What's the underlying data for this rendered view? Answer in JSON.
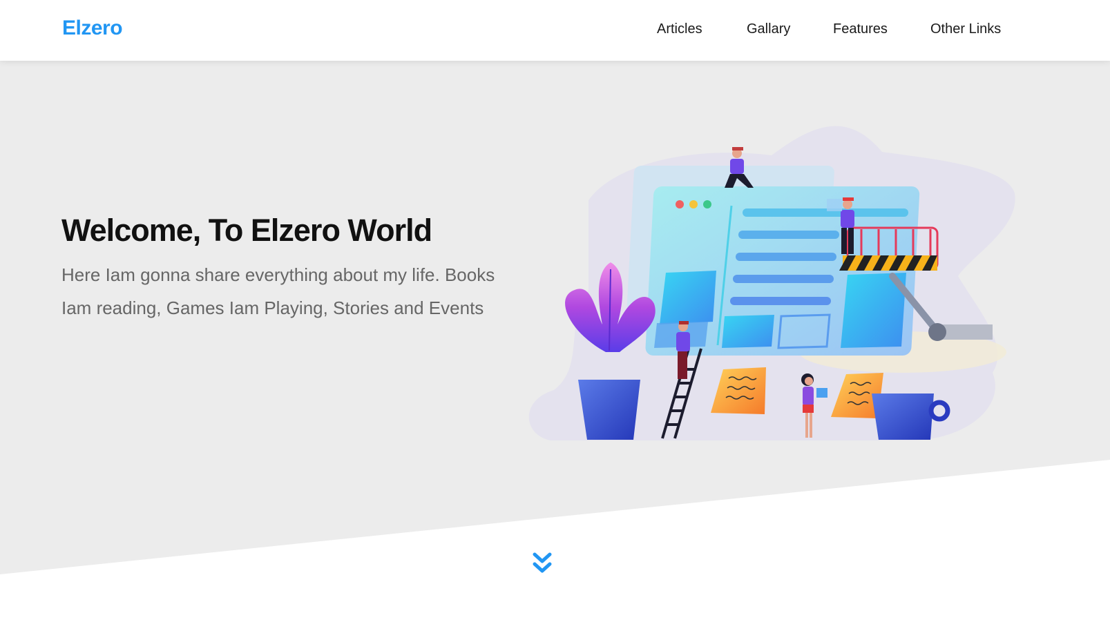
{
  "header": {
    "logo": "Elzero",
    "nav": [
      "Articles",
      "Gallary",
      "Features",
      "Other Links"
    ]
  },
  "hero": {
    "title": "Welcome, To Elzero World",
    "description": "Here Iam gonna share everything about my life. Books Iam reading, Games Iam Playing, Stories and Events"
  },
  "icons": {
    "scroll_down": "double-chevron-down-icon",
    "illustration": "website-builders-illustration"
  },
  "colors": {
    "accent": "#2196f3",
    "hero_bg": "#ececec",
    "text_dark": "#111111",
    "text_muted": "#666666"
  }
}
